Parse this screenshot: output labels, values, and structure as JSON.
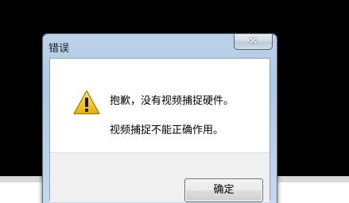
{
  "dialog": {
    "title": "错误",
    "close_symbol": "✕",
    "icon": "warning-icon",
    "message_line1": "抱歉，没有视频捕捉硬件。",
    "message_line2": "视频捕捉不能正确作用。",
    "ok_label": "确定"
  },
  "colors": {
    "desktop": "#000000",
    "warning_fill": "#f5c400",
    "close_button": "#c7452a"
  }
}
